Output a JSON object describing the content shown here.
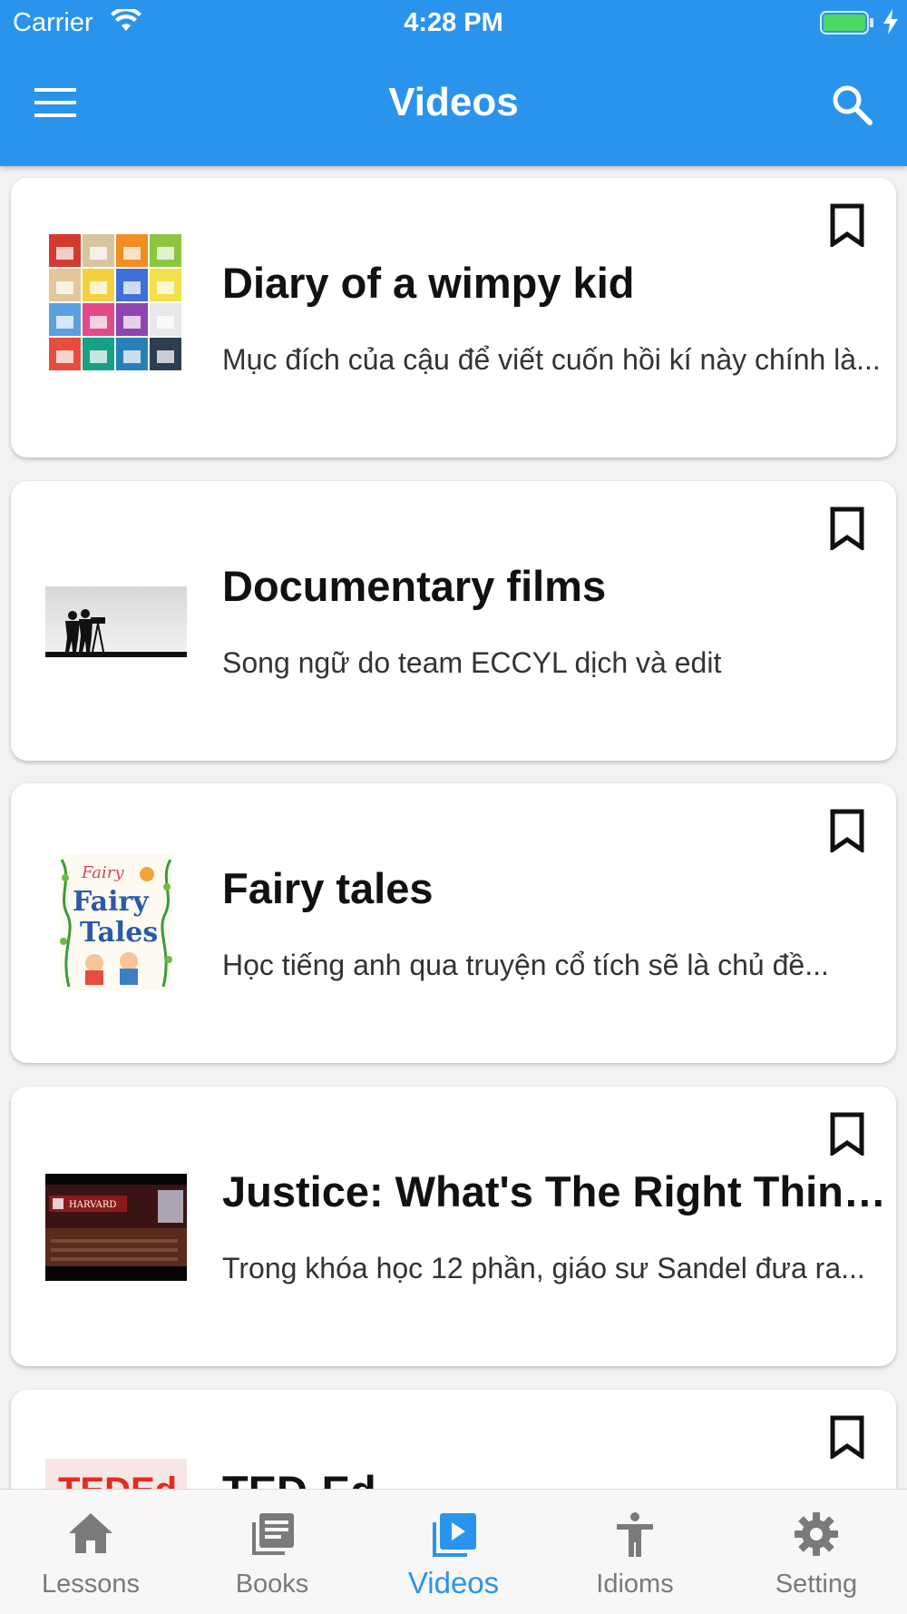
{
  "status_bar": {
    "carrier": "Carrier",
    "time": "4:28 PM"
  },
  "app_bar": {
    "title": "Videos",
    "menu_icon": "menu-icon",
    "search_icon": "search-icon"
  },
  "items": [
    {
      "title": "Diary of a wimpy kid",
      "description": "Mục đích của cậu để viết cuốn hồi kí này chính là...",
      "bookmark_icon": "bookmark-icon"
    },
    {
      "title": "Documentary films",
      "description": "Song ngữ do team ECCYL dịch và edit",
      "bookmark_icon": "bookmark-icon"
    },
    {
      "title": "Fairy tales",
      "description": "Học tiếng anh qua truyện cổ tích sẽ là chủ đề...",
      "bookmark_icon": "bookmark-icon"
    },
    {
      "title": "Justice: What's The Right Thing To Do?",
      "description": "Trong khóa học 12 phần, giáo sư Sandel đưa ra...",
      "bookmark_icon": "bookmark-icon"
    },
    {
      "title": "TED-Ed",
      "description": "",
      "bookmark_icon": "bookmark-icon"
    }
  ],
  "thumbnails": {
    "harvard_text": "HARVARD",
    "fairy_text_1": "Fairy",
    "fairy_text_2": "Fairy",
    "fairy_text_3": "Tales",
    "ted_text": "TEDEd"
  },
  "bottom_nav": [
    {
      "label": "Lessons",
      "icon": "home-icon",
      "active": false
    },
    {
      "label": "Books",
      "icon": "library-books-icon",
      "active": false
    },
    {
      "label": "Videos",
      "icon": "video-library-icon",
      "active": true
    },
    {
      "label": "Idioms",
      "icon": "accessibility-icon",
      "active": false
    },
    {
      "label": "Setting",
      "icon": "gear-icon",
      "active": false
    }
  ],
  "colors": {
    "primary": "#2a94ed",
    "inactive": "#7a7a7a"
  }
}
